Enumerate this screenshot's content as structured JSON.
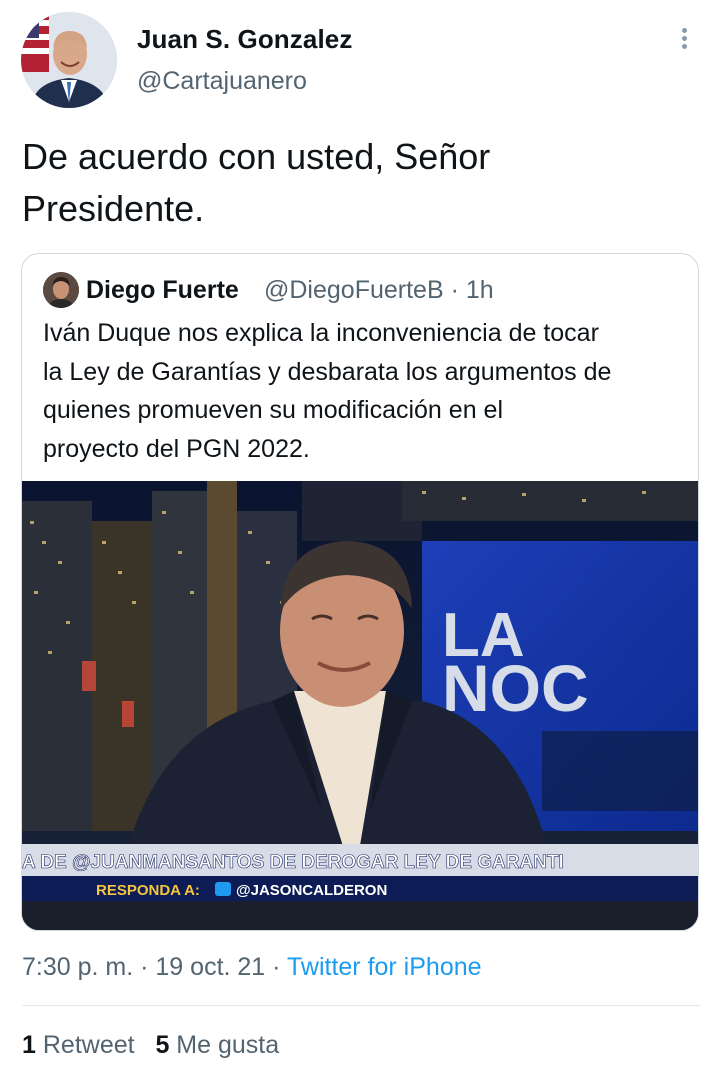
{
  "author": {
    "name": "Juan S. Gonzalez",
    "handle": "@Cartajuanero"
  },
  "tweet": {
    "text_line1": "De acuerdo con usted, Señor",
    "text_line2": "Presidente."
  },
  "quoted_tweet": {
    "name": "Diego Fuerte",
    "handle": "@DiegoFuerteB",
    "separator": "·",
    "time": "1h",
    "text_line1": "Iván Duque nos explica la inconveniencia de tocar",
    "text_line2": "la Ley de Garantías y desbarata los argumentos de",
    "text_line3": "quienes promueven su modificación en el",
    "text_line4": "proyecto del PGN 2022.",
    "media": {
      "set_sign_line1": "LA",
      "set_sign_line2": "NOC",
      "ticker_text": "A DE @JUANMANSANTOS DE DEROGAR LEY DE GARANTI",
      "respond_label": "RESPONDA A:",
      "respond_handle": "@JASONCALDERON"
    }
  },
  "meta": {
    "time": "7:30 p. m.",
    "sep1": "·",
    "date": "19 oct. 21",
    "sep2": "·",
    "source": "Twitter for iPhone"
  },
  "stats": {
    "retweet_count": "1",
    "retweet_label": "Retweet",
    "like_count": "5",
    "like_label": "Me gusta"
  },
  "colors": {
    "text": "#0f1419",
    "secondary": "#536471",
    "accent": "#1d9bf0",
    "border": "#cfd9de"
  },
  "icons": {
    "more": "more-vertical-icon",
    "twitter": "twitter-bird-icon"
  }
}
